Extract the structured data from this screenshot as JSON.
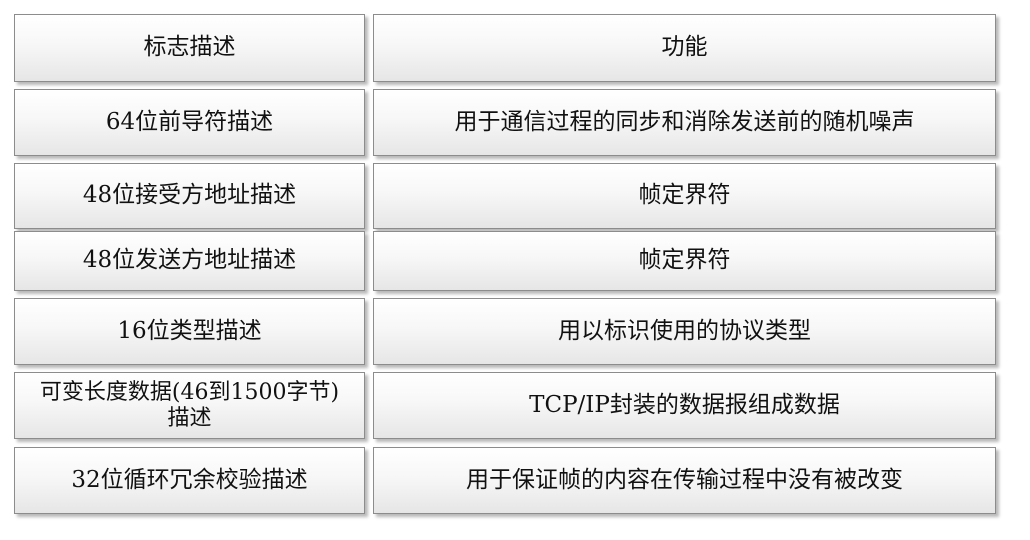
{
  "table": {
    "header": {
      "left": "标志描述",
      "right": "功能"
    },
    "rows": [
      {
        "left": "64位前导符描述",
        "right": "用于通信过程的同步和消除发送前的随机噪声"
      },
      {
        "left": "48位接受方地址描述",
        "right": "帧定界符"
      },
      {
        "left": "48位发送方地址描述",
        "right": "帧定界符"
      },
      {
        "left": "16位类型描述",
        "right": "用以标识使用的协议类型"
      },
      {
        "left": "可变长度数据(46到1500字节)描述",
        "right": "TCP/IP封装的数据报组成数据"
      },
      {
        "left": "32位循环冗余校验描述",
        "right": "用于保证帧的内容在传输过程中没有被改变"
      }
    ]
  }
}
